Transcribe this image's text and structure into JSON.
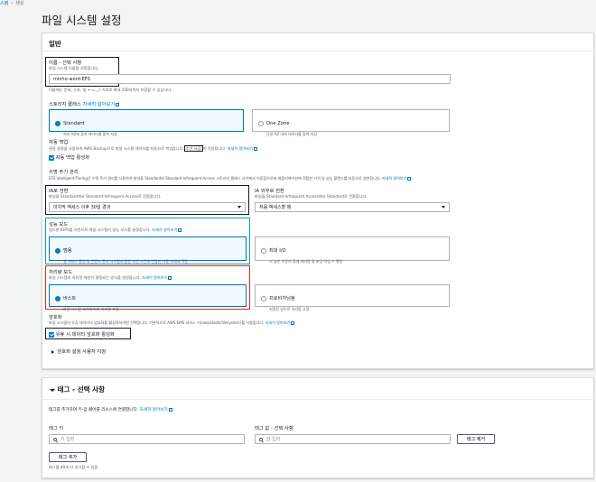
{
  "breadcrumb": {
    "parent": "스템",
    "current": "생성"
  },
  "page_title": "파일 시스템 설정",
  "general": {
    "title": "일반",
    "name": {
      "label": "이름 - 선택 사항",
      "desc": "파일 시스템 이름을 지정합니다.",
      "value": "minho-word-EFS",
      "hint": "이름에는 문자, 숫자, 및 +-=._:/ 기호로 최대 256자까지 포함할 수 있습니다."
    },
    "storage_class": {
      "label": "스토리지 클래스",
      "link": "자세히 알아보기",
      "options": [
        {
          "title": "Standard",
          "desc": "여러 AZ에 걸쳐 데이터를 중복 저장"
        },
        {
          "title": "One Zone",
          "desc": "단일 AZ 내에 데이터를 중복 저장"
        }
      ]
    },
    "backup": {
      "label": "자동 백업",
      "desc_before": "권장 설정을 사용하여 AWS Backup으로 파일 시스템 데이터를 자동으로 백업합니다.",
      "desc_boxed": "추가 요금",
      "desc_after": "이 적용됩니다.",
      "link": "자세히 알아보기",
      "checkbox": "자동 백업 활성화"
    },
    "lifecycle": {
      "label": "수명 주기 관리",
      "desc": "EFS Intelligent-Tiering은 수명 주기 관리를 사용하여 파일을 Standard와 Standard-Infrequent Access 스토리지 클래스 사이에서 이동함으로써 애플리케이션에 적합한 가격 및 성능 블렌드를 자동으로 실현합니다.",
      "link": "자세히 알아보기",
      "ia": {
        "label": "IA로 전환",
        "desc": "파일을 Standard에서 Standard-Infrequent Access로 전환합니다.",
        "value": "마지막 액세스 이후 30일 경과"
      },
      "ia_out": {
        "label": "IA 외부로 전환",
        "desc": "파일을 Standard-Infrequent Access에서 Standard로 전환합니다.",
        "value": "처음 액세스할 때"
      }
    },
    "performance": {
      "label": "성능 모드",
      "desc": "일드한 IOPS를 기반으로 파일 시스템의 성능 모드를 설정합니다.",
      "link": "자세히 알아보기",
      "options": [
        {
          "title": "범용",
          "desc": "웹 서비스 환경 및 콘텐츠 관리 시스템과 같은 지연 시간에 민감한 사용 사례에 적합"
        },
        {
          "title": "최대 I/O",
          "desc": "더 높은 수준의 집계 처리량 및 초당 작업 수 확장"
        }
      ]
    },
    "throughput": {
      "label": "처리량 모드",
      "desc": "파일 시스템의 처리량 제한이 결정되는 방식을 설정합니다.",
      "link": "자세히 알아보기",
      "options": [
        {
          "title": "버스트",
          "desc": "파일 시스템 크기에 따라 처리량 조정"
        },
        {
          "title": "프로비저닝됨",
          "desc": "지정된 양으로 처리량 고정"
        }
      ]
    },
    "encryption": {
      "label": "암호화",
      "desc": "파일 시스템의 유휴 데이터의 암호화를 활성화하려면 선택합니다. 기본적으로 AWS KMS 서비스 키(aws/elasticfilesystem)를 사용합니다.",
      "link": "자세히 알아보기",
      "checkbox": "유휴 시 데이터 암호화 활성화",
      "custom": "암호화 설정 사용자 지정"
    }
  },
  "tags": {
    "title": "태그 - 선택 사항",
    "desc": "태그를 추가하여 키-값 페어를 리소스에 연결합니다.",
    "link": "자세히 알아보기",
    "key_label": "태그 키",
    "key_placeholder": "키 입력",
    "value_label": "태그 값 - 선택 사항",
    "value_placeholder": "값 입력",
    "remove_button": "태그 제거",
    "add_button": "태그 추가",
    "limit": "태그를 49개 더 추가할 수 있음"
  },
  "colors": {
    "accent": "#0073bb",
    "annotation_black": "#16191f",
    "annotation_blue": "#00a1c9",
    "annotation_red": "#d13212"
  }
}
